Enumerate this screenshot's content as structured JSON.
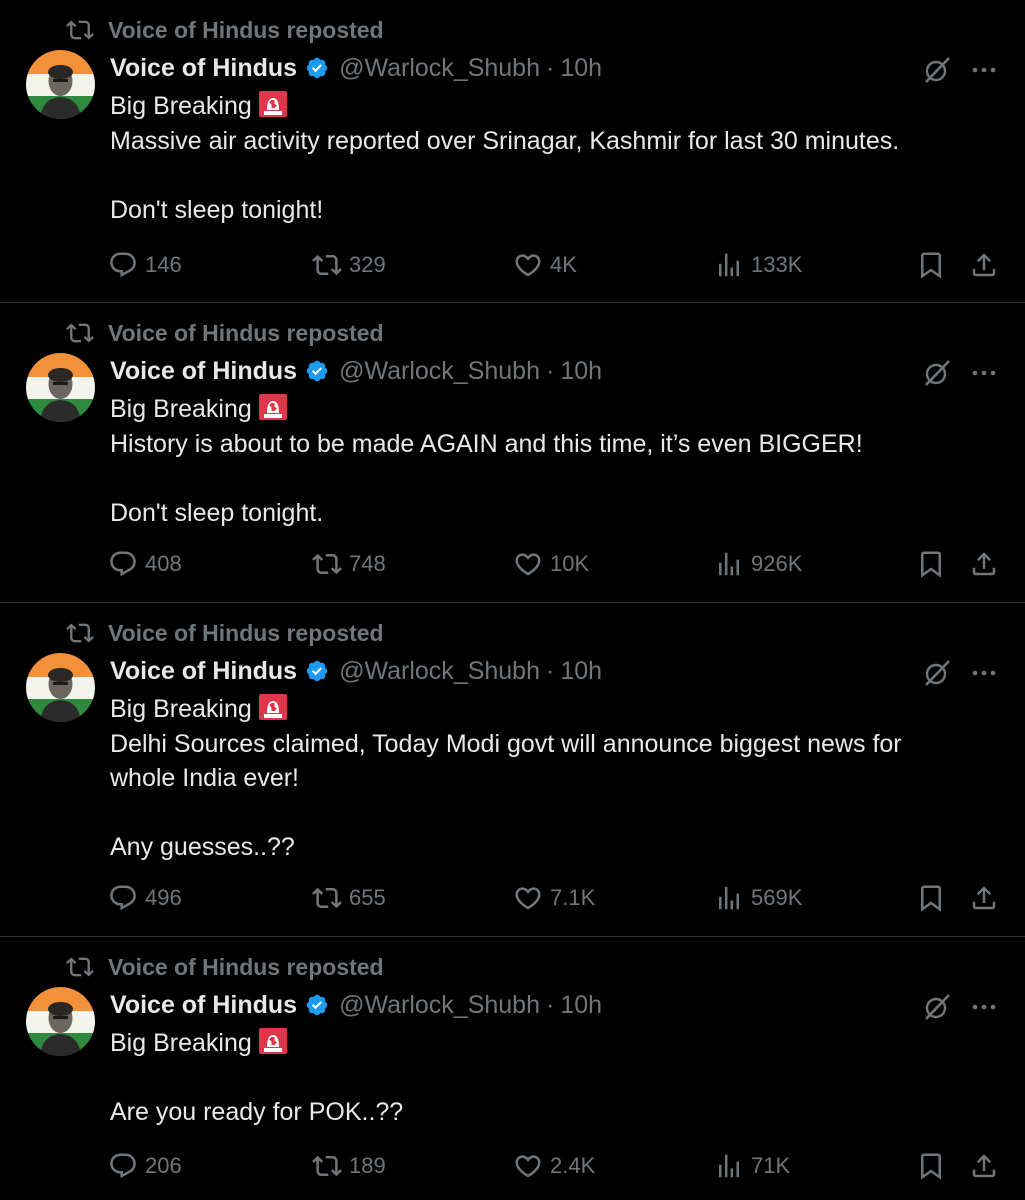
{
  "colors": {
    "background": "#000000",
    "text_primary": "#e7e9ea",
    "text_secondary": "#71767b",
    "divider": "#2f3336",
    "verified_blue": "#1d9bf0",
    "siren_red": "#e0354b"
  },
  "posts": [
    {
      "repost_label": "Voice of Hindus reposted",
      "display_name": "Voice of Hindus",
      "handle": "@Warlock_Shubh",
      "separator": "·",
      "time": "10h",
      "lines": [
        "Big Breaking",
        "Massive air activity reported over Srinagar, Kashmir for last 30 minutes.",
        "",
        "Don't sleep tonight!"
      ],
      "replies": "146",
      "reposts": "329",
      "likes": "4K",
      "views": "133K"
    },
    {
      "repost_label": "Voice of Hindus reposted",
      "display_name": "Voice of Hindus",
      "handle": "@Warlock_Shubh",
      "separator": "·",
      "time": "10h",
      "lines": [
        "Big Breaking",
        "History is about to be made AGAIN and this time, it’s even BIGGER!",
        "",
        "Don't sleep tonight."
      ],
      "replies": "408",
      "reposts": "748",
      "likes": "10K",
      "views": "926K"
    },
    {
      "repost_label": "Voice of Hindus reposted",
      "display_name": "Voice of Hindus",
      "handle": "@Warlock_Shubh",
      "separator": "·",
      "time": "10h",
      "lines": [
        "Big Breaking",
        "Delhi Sources claimed, Today Modi govt will announce biggest news for",
        "whole India ever!",
        "",
        "Any guesses..??"
      ],
      "replies": "496",
      "reposts": "655",
      "likes": "7.1K",
      "views": "569K"
    },
    {
      "repost_label": "Voice of Hindus reposted",
      "display_name": "Voice of Hindus",
      "handle": "@Warlock_Shubh",
      "separator": "·",
      "time": "10h",
      "lines": [
        "Big Breaking",
        "",
        "Are you ready for POK..??"
      ],
      "replies": "206",
      "reposts": "189",
      "likes": "2.4K",
      "views": "71K"
    }
  ],
  "icons": {
    "repost": "repost-icon",
    "verified": "verified-badge-icon",
    "grok": "grok-icon",
    "more": "more-icon",
    "siren": "siren-emoji-icon",
    "reply": "reply-icon",
    "like": "like-icon",
    "views": "views-icon",
    "bookmark": "bookmark-icon",
    "share": "share-icon"
  }
}
